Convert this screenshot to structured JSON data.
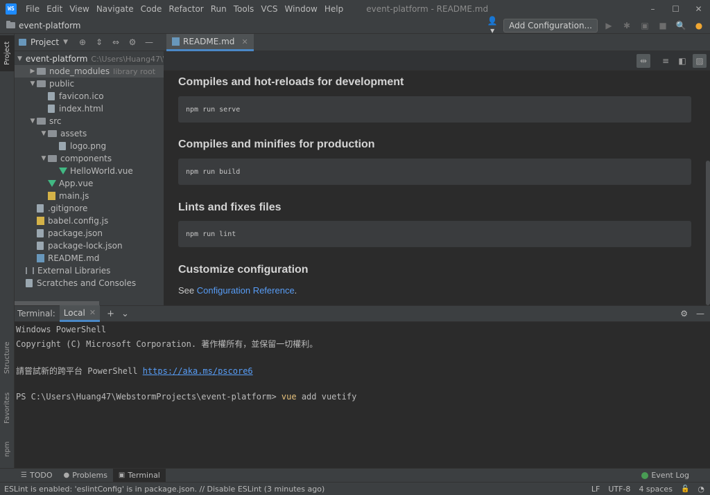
{
  "menubar": {
    "logo_text": "WS",
    "items": [
      "File",
      "Edit",
      "View",
      "Navigate",
      "Code",
      "Refactor",
      "Run",
      "Tools",
      "VCS",
      "Window",
      "Help"
    ],
    "window_title": "event-platform - README.md",
    "controls": {
      "minimize": "–",
      "maximize": "☐",
      "close": "✕"
    }
  },
  "navbar": {
    "project_name": "event-platform",
    "user_icon": "👤▾",
    "add_configuration": "Add Configuration...",
    "run_icon": "▶",
    "debug_icon": "✱",
    "coverage_icon": "▣",
    "stop_icon": "■",
    "search_icon": "🔍",
    "update_icon": "●",
    "update_color": "#f0a732"
  },
  "left_strip": {
    "project_tab": "Project",
    "structure_tab": "Structure",
    "favorites_tab": "Favorites",
    "npm_tab": "npm"
  },
  "project_panel": {
    "selector_label": "Project",
    "selector_arrow": "▼",
    "tools": {
      "locate": "⊕",
      "expand": "⇕",
      "collapse": "⇔",
      "settings": "⚙",
      "hide": "—"
    },
    "tree": [
      {
        "label": "event-platform",
        "hint": "C:\\Users\\Huang47\\W",
        "arrow": "▼",
        "icon": "folder"
      },
      {
        "label": "node_modules",
        "hint": "library root",
        "arrow": "▶",
        "icon": "folder"
      },
      {
        "label": "public",
        "hint": "",
        "arrow": "▼",
        "icon": "folder"
      },
      {
        "label": "favicon.ico",
        "hint": "",
        "arrow": "",
        "icon": "file"
      },
      {
        "label": "index.html",
        "hint": "",
        "arrow": "",
        "icon": "file"
      },
      {
        "label": "src",
        "hint": "",
        "arrow": "▼",
        "icon": "folder"
      },
      {
        "label": "assets",
        "hint": "",
        "arrow": "▼",
        "icon": "folder"
      },
      {
        "label": "logo.png",
        "hint": "",
        "arrow": "",
        "icon": "file"
      },
      {
        "label": "components",
        "hint": "",
        "arrow": "▼",
        "icon": "folder"
      },
      {
        "label": "HelloWorld.vue",
        "hint": "",
        "arrow": "",
        "icon": "vue"
      },
      {
        "label": "App.vue",
        "hint": "",
        "arrow": "",
        "icon": "vue"
      },
      {
        "label": "main.js",
        "hint": "",
        "arrow": "",
        "icon": "js"
      },
      {
        "label": ".gitignore",
        "hint": "",
        "arrow": "",
        "icon": "file"
      },
      {
        "label": "babel.config.js",
        "hint": "",
        "arrow": "",
        "icon": "js"
      },
      {
        "label": "package.json",
        "hint": "",
        "arrow": "",
        "icon": "file"
      },
      {
        "label": "package-lock.json",
        "hint": "",
        "arrow": "",
        "icon": "file"
      },
      {
        "label": "README.md",
        "hint": "",
        "arrow": "",
        "icon": "md"
      },
      {
        "label": "External Libraries",
        "hint": "",
        "arrow": "",
        "icon": "lib"
      },
      {
        "label": "Scratches and Consoles",
        "hint": "",
        "arrow": "",
        "icon": "file"
      }
    ]
  },
  "editor": {
    "tab_label": "README.md",
    "tab_close": "✕",
    "toolbar": {
      "editor_and_preview": "⇹",
      "editor_only": "≡",
      "preview_only": "◧",
      "image": "▨"
    },
    "sections": [
      {
        "heading": "Compiles and hot-reloads for development",
        "code": "npm run serve"
      },
      {
        "heading": "Compiles and minifies for production",
        "code": "npm run build"
      },
      {
        "heading": "Lints and fixes files",
        "code": "npm run lint"
      }
    ],
    "last_heading": "Customize configuration",
    "see_text": "See ",
    "link_text": "Configuration Reference",
    "trailing": "."
  },
  "terminal": {
    "label": "Terminal:",
    "tab": "Local",
    "tab_close": "✕",
    "add_icon": "+",
    "dropdown_icon": "⌄",
    "settings_icon": "⚙",
    "hide_icon": "—",
    "lines": {
      "l1": "Windows PowerShell",
      "l2": "Copyright (C) Microsoft Corporation. 著作權所有，並保留一切權利。",
      "l3_prefix": "請嘗試新的跨平台 PowerShell ",
      "l3_link": "https://aka.ms/pscore6",
      "l4_prompt": "PS C:\\Users\\Huang47\\WebstormProjects\\event-platform> ",
      "l4_cmd": "vue",
      "l4_args": " add vuetify"
    }
  },
  "bottom_tabs": {
    "todo": "TODO",
    "problems": "Problems",
    "terminal": "Terminal",
    "event_log": "Event Log"
  },
  "statusbar": {
    "message": "ESLint is enabled: 'eslintConfig' is in package.json. // Disable ESLint (3 minutes ago)",
    "line_sep": "LF",
    "encoding": "UTF-8",
    "indent": "4 spaces",
    "lock_icon": "🔓",
    "inspect_icon": "◔"
  }
}
